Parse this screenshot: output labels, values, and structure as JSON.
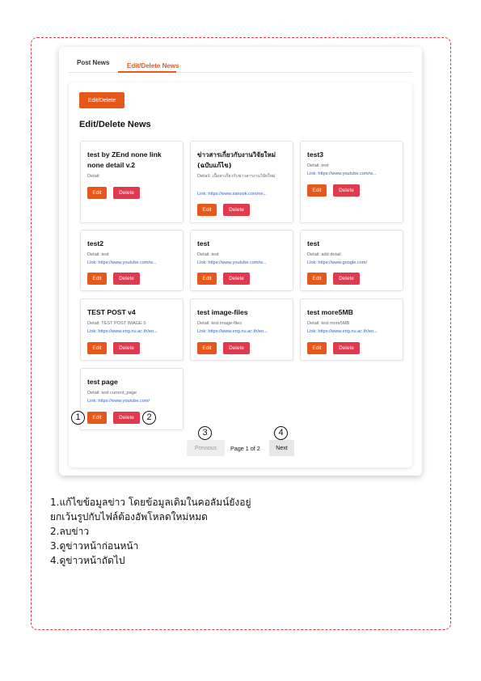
{
  "tabs": [
    {
      "label": "Post News",
      "active": false
    },
    {
      "label": "Edit/Delete News",
      "active": true
    }
  ],
  "top_button_label": "Edit/Delete",
  "section_title": "Edit/Delete News",
  "cards": [
    {
      "title": "test by ZEnd none link none detail v.2",
      "detail": "Detail:",
      "link": "",
      "edit": "Edit",
      "delete": "Delete"
    },
    {
      "title": "ข่าวสารเกี่ยวกับงานวิจัยใหม่ (ฉบับแก้ไข)",
      "detail": "Detail: เนื้อหาเกี่ยวกับข่าวสารงานวิจัยใหม่",
      "link": "Link: https://www.sanook.com/ne...",
      "edit": "Edit",
      "delete": "Delete"
    },
    {
      "title": "test3",
      "detail": "Detail: test",
      "link": "Link: https://www.youtube.com/w...",
      "edit": "Edit",
      "delete": "Delete"
    },
    {
      "title": "test2",
      "detail": "Detail: test",
      "link": "Link: https://www.youtube.com/w...",
      "edit": "Edit",
      "delete": "Delete"
    },
    {
      "title": "test",
      "detail": "Detail: test",
      "link": "Link: https://www.youtube.com/w...",
      "edit": "Edit",
      "delete": "Delete"
    },
    {
      "title": "test",
      "detail": "Detail: add detail",
      "link": "Link: https://www.google.com/",
      "edit": "Edit",
      "delete": "Delete"
    },
    {
      "title": "TEST POST v4",
      "detail": "Detail: TEST POST IMAGE 5",
      "link": "Link: https://www.eng.nu.ac.th/en...",
      "edit": "Edit",
      "delete": "Delete"
    },
    {
      "title": "test image-files",
      "detail": "Detail: test image-files",
      "link": "Link: https://www.eng.nu.ac.th/en...",
      "edit": "Edit",
      "delete": "Delete"
    },
    {
      "title": "test more5MB",
      "detail": "Detail: test more5MB",
      "link": "Link: https://www.eng.nu.ac.th/en...",
      "edit": "Edit",
      "delete": "Delete"
    },
    {
      "title": "test page",
      "detail": "Detail: test current_page",
      "link": "Link: https://www.youtube.com/",
      "edit": "Edit",
      "delete": "Delete"
    }
  ],
  "pagination": {
    "previous": "Previous",
    "page_info": "Page 1 of 2",
    "next": "Next"
  },
  "callouts": [
    "1",
    "2",
    "3",
    "4"
  ],
  "instructions": [
    "1.แก้ไขข้อมูลข่าว โดยข้อมูลเดิมในคอลัมน์ยังอยู่",
    "ยกเว้นรูปกับไฟล์ต้องอัพโหลดใหม่หมด",
    "2.ลบข่าว",
    "3.ดูข่าวหน้าก่อนหน้า",
    "4.ดูข่าวหน้าถัดไป"
  ],
  "colors": {
    "accent": "#e8571a",
    "delete": "#e23a4d",
    "frame": "#d9393b",
    "link": "#2b64c4"
  }
}
